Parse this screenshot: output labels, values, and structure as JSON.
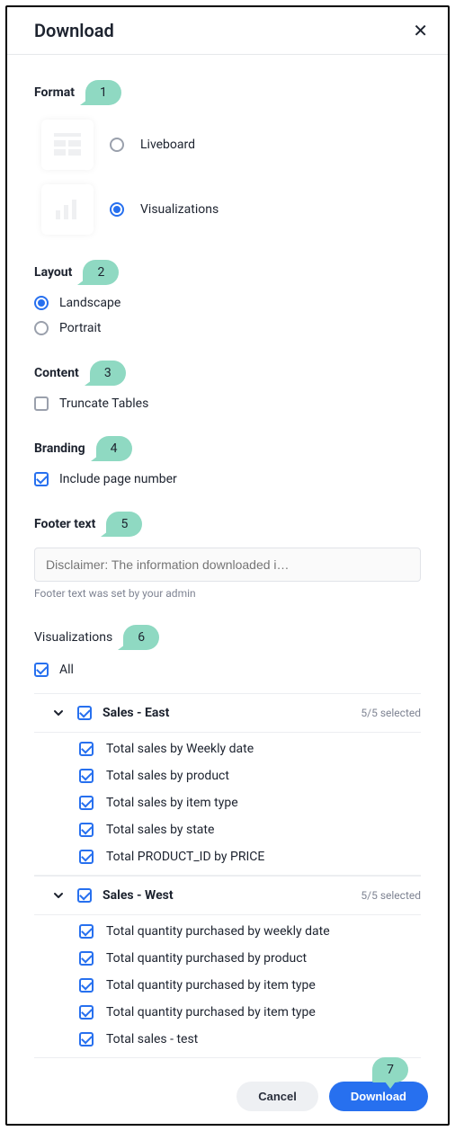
{
  "title": "Download",
  "callouts": [
    "1",
    "2",
    "3",
    "4",
    "5",
    "6",
    "7"
  ],
  "format": {
    "label": "Format",
    "options": [
      {
        "label": "Liveboard",
        "selected": false
      },
      {
        "label": "Visualizations",
        "selected": true
      }
    ]
  },
  "layout": {
    "label": "Layout",
    "options": [
      {
        "label": "Landscape",
        "selected": true
      },
      {
        "label": "Portrait",
        "selected": false
      }
    ]
  },
  "content": {
    "label": "Content",
    "truncate_label": "Truncate Tables",
    "truncate_checked": false
  },
  "branding": {
    "label": "Branding",
    "pagenum_label": "Include page number",
    "pagenum_checked": true
  },
  "footer_text": {
    "label": "Footer text",
    "placeholder": "Disclaimer: The information downloaded i…",
    "hint": "Footer text was set by your admin"
  },
  "viz": {
    "label": "Visualizations",
    "all_label": "All",
    "groups": [
      {
        "name": "Sales - East",
        "count": "5/5 selected",
        "items": [
          "Total sales by Weekly date",
          "Total sales by product",
          "Total sales by item type",
          "Total sales by state",
          "Total PRODUCT_ID by PRICE"
        ]
      },
      {
        "name": "Sales - West",
        "count": "5/5 selected",
        "items": [
          "Total quantity purchased by weekly date",
          "Total quantity purchased by product",
          "Total quantity purchased by item type",
          "Total quantity purchased by item type",
          "Total sales - test"
        ]
      }
    ]
  },
  "buttons": {
    "cancel": "Cancel",
    "download": "Download"
  }
}
